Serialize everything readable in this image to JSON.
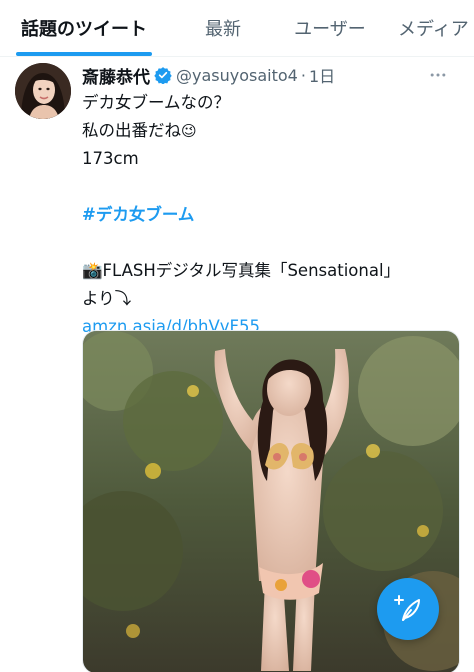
{
  "tabs": [
    {
      "label": "話題のツイート",
      "active": true
    },
    {
      "label": "最新",
      "active": false
    },
    {
      "label": "ユーザー",
      "active": false
    },
    {
      "label": "メディア",
      "active": false
    }
  ],
  "tweet": {
    "author_name": "斎藤恭代",
    "verified": true,
    "handle": "@yasuyosaito4",
    "separator": "·",
    "time": "1日",
    "more_icon": "more-horizontal-icon",
    "lines": {
      "l1": "デカ女ブームなの？",
      "l2": "私の出番だね",
      "l2_emoji": "😉",
      "l3": "173cm",
      "hashtag": "#デカ女ブーム",
      "promo_icon": "📸",
      "promo": "FLASHデジタル写真集「Sensational」",
      "promo2": "より⤵︎",
      "link": "amzn.asia/d/bhVvF55"
    },
    "media": {
      "type": "photo",
      "icon": "photo"
    }
  },
  "compose_button": {
    "icon": "feather-plus-icon"
  },
  "colors": {
    "accent": "#1d9bf0",
    "text_primary": "#0f1419",
    "text_secondary": "#536471"
  }
}
